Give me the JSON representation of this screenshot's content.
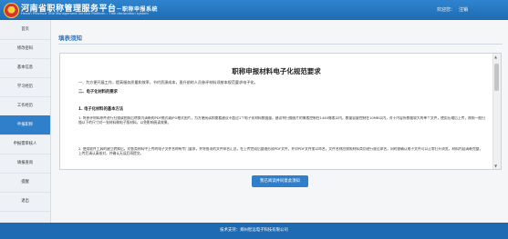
{
  "header": {
    "title": "河南省职称管理服务平台",
    "title_suffix": "－职称申报系统",
    "subtitle": "Henan Province Title Management Service Platform – Title declaration system",
    "welcome": "欢迎您：",
    "logout": "注销"
  },
  "sidebar": {
    "items": [
      {
        "label": "首页"
      },
      {
        "label": "修改密码"
      },
      {
        "label": "基本信息"
      },
      {
        "label": "学习经历"
      },
      {
        "label": "工作经历"
      },
      {
        "label": "申报职称"
      },
      {
        "label": "申报需审核人"
      },
      {
        "label": "填报查询"
      },
      {
        "label": "提醒"
      },
      {
        "label": "退出"
      }
    ],
    "active_index": 5
  },
  "main": {
    "page_title": "填表须知",
    "doc": {
      "title": "职称申报材料电子化规范要求",
      "line1": "一、为方便开展工作，提高服务质量和效率，节约资源成本，晋升前的人员参评材料须按本规范要求电子化。",
      "heading2": "二、电子化材料的要求",
      "heading3": "1. 电子化材料的基本方法",
      "para1": "1. 将参评材料原件进行扫描或拍照后转换为清晰的PDF格式或JPG格式图片，为方便阅读和查看建议不超过1个电子化材料数据量，建议将扫描图片的像素控制在1440像素以内，数量容量控制在10MB以内，对于内容所数据较大的单个文件，使用压缩后上传，按照一般扫描以下的尺寸对一张材料做电子版材料，以免影响阅读效果。",
      "para2": "2. 使用软件工具的建立转换后，对各类材料中上传的电子文件名称有专门要求，并将各项的文件命名汇总，在上传完成后整理形成PDF文件，并对PDF文件加以命名，文件名称应按照材料类别进行规范命名，同时需确认电子文件可以正常打开浏览，材料内容清晰完整，上传后请认真核对，并确认无误后再提交。"
    },
    "agree_button": "我已阅读并同意此须知"
  },
  "footer": {
    "text": "技术支持：郑州智远电子科技有限公司"
  },
  "colors": {
    "header_blue": "#2f84cf",
    "active_nav": "#2f7fca",
    "footer_blue": "#1f6bb3",
    "title_blue": "#2a77c4"
  }
}
